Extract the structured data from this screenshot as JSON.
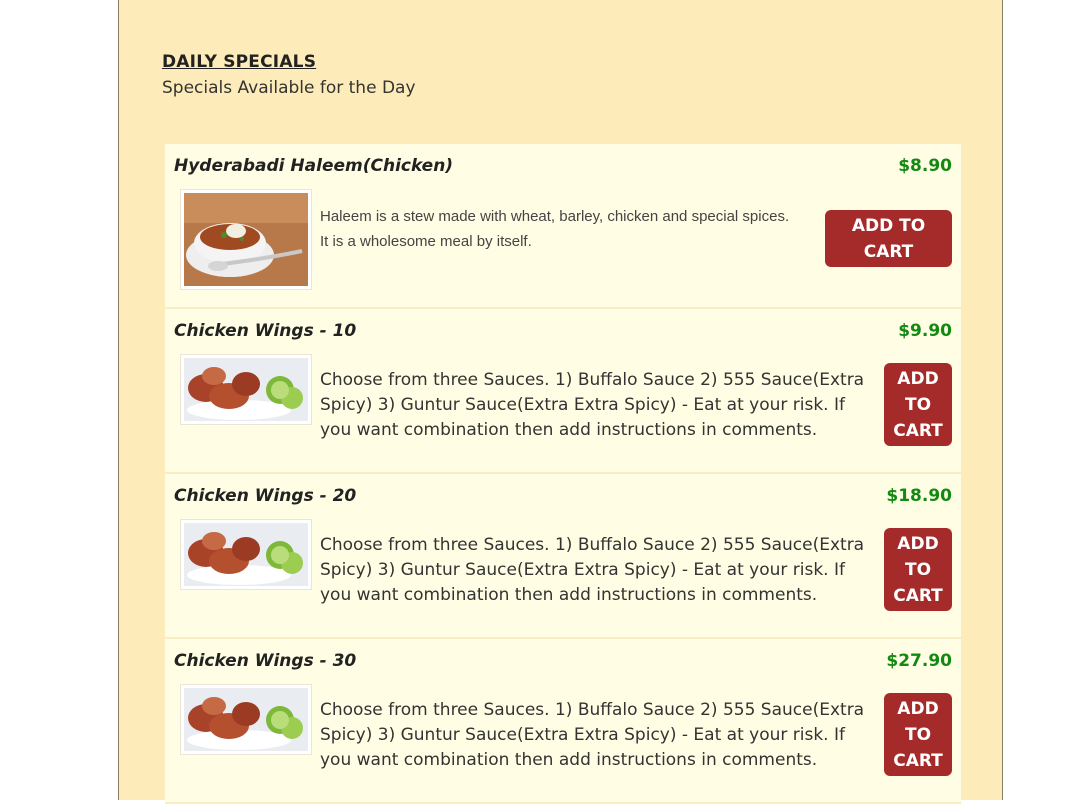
{
  "section": {
    "title": "DAILY SPECIALS",
    "subtitle": "Specials Available for the Day"
  },
  "items": [
    {
      "name": "Hyderabadi Haleem(Chicken)",
      "price": "$8.90",
      "description": "Haleem is a stew made with wheat, barley, chicken and special spices. It is a wholesome meal by itself.",
      "button": "ADD TO CART",
      "image": "haleem-bowl"
    },
    {
      "name": "Chicken Wings - 10",
      "price": "$9.90",
      "description": "Choose from three Sauces. 1) Buffalo Sauce 2) 555 Sauce(Extra Spicy) 3) Guntur Sauce(Extra Extra Spicy) - Eat at your risk. If you want combination then add instructions in comments.",
      "button": "ADD TO CART",
      "image": "chicken-wings"
    },
    {
      "name": "Chicken Wings - 20",
      "price": "$18.90",
      "description": "Choose from three Sauces. 1) Buffalo Sauce 2) 555 Sauce(Extra Spicy) 3) Guntur Sauce(Extra Extra Spicy) - Eat at your risk. If you want combination then add instructions in comments.",
      "button": "ADD TO CART",
      "image": "chicken-wings"
    },
    {
      "name": "Chicken Wings - 30",
      "price": "$27.90",
      "description": "Choose from three Sauces. 1) Buffalo Sauce 2) 555 Sauce(Extra Spicy) 3) Guntur Sauce(Extra Extra Spicy) - Eat at your risk. If you want combination then add instructions in comments.",
      "button": "ADD TO CART",
      "image": "chicken-wings"
    }
  ],
  "colors": {
    "panel_background": "#fdecb9",
    "card_background": "#fffde3",
    "price": "#128a12",
    "button": "#a52a2a"
  }
}
